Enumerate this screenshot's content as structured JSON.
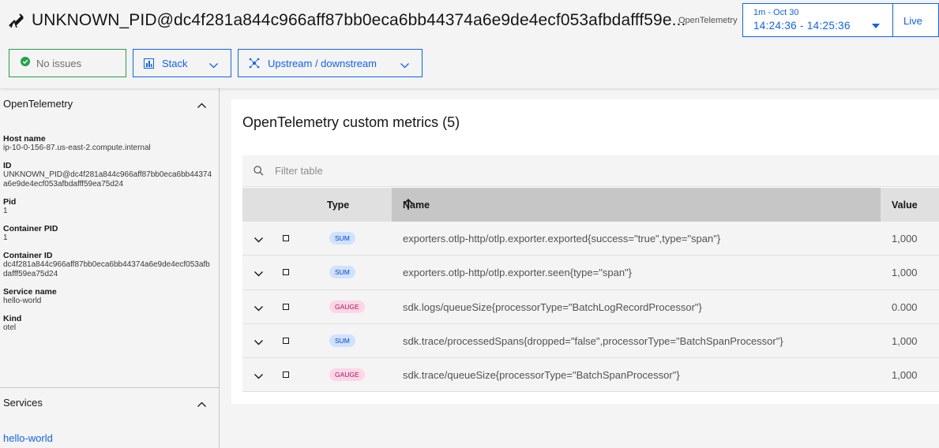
{
  "header": {
    "title": "UNKNOWN_PID@dc4f281a844c966aff87bb0eca6bb44374a6e9de4ecf053afbdafff59e...",
    "source_label": "OpenTelemetry",
    "time_range_label": "1m - Oct 30",
    "time_range_value": "14:24:36 - 14:25:36",
    "live_label": "Live",
    "status_label": "No issues",
    "stack_label": "Stack",
    "upstream_label": "Upstream / downstream"
  },
  "sidebar": {
    "section_title": "OpenTelemetry",
    "properties": [
      {
        "key": "Host name",
        "value": "ip-10-0-156-87.us-east-2.compute.internal"
      },
      {
        "key": "ID",
        "value": "UNKNOWN_PID@dc4f281a844c966aff87bb0eca6bb44374a6e9de4ecf053afbdafff59ea75d24"
      },
      {
        "key": "Pid",
        "value": "1"
      },
      {
        "key": "Container PID",
        "value": "1"
      },
      {
        "key": "Container ID",
        "value": "dc4f281a844c966aff87bb0eca6bb44374a6e9de4ecf053afbdafff59ea75d24"
      },
      {
        "key": "Service name",
        "value": "hello-world"
      },
      {
        "key": "Kind",
        "value": "otel"
      }
    ],
    "services_title": "Services",
    "services": [
      "hello-world"
    ]
  },
  "main": {
    "title": "OpenTelemetry custom metrics (5)",
    "filter_placeholder": "Filter table",
    "columns": {
      "type": "Type",
      "name": "Name",
      "value": "Value"
    },
    "rows": [
      {
        "type": "SUM",
        "name": "exporters.otlp-http/otlp.exporter.exported{success=\"true\",type=\"span\"}",
        "value": "1,000"
      },
      {
        "type": "SUM",
        "name": "exporters.otlp-http/otlp.exporter.seen{type=\"span\"}",
        "value": "1,000"
      },
      {
        "type": "GAUGE",
        "name": "sdk.logs/queueSize{processorType=\"BatchLogRecordProcessor\"}",
        "value": "0.000"
      },
      {
        "type": "SUM",
        "name": "sdk.trace/processedSpans{dropped=\"false\",processorType=\"BatchSpanProcessor\"}",
        "value": "1,000"
      },
      {
        "type": "GAUGE",
        "name": "sdk.trace/queueSize{processorType=\"BatchSpanProcessor\"}",
        "value": "1,000"
      }
    ]
  },
  "colors": {
    "accent": "#0f62fe",
    "success": "#24a148",
    "sum_tag_bg": "#d0e2ff",
    "gauge_tag_bg": "#ffd6e8"
  },
  "icons": {
    "title": "telescope-icon",
    "status": "checkmark-circle-icon",
    "stack": "stack-chart-icon",
    "upstream": "topology-icon",
    "search": "search-icon",
    "sort": "arrow-up-icon"
  }
}
